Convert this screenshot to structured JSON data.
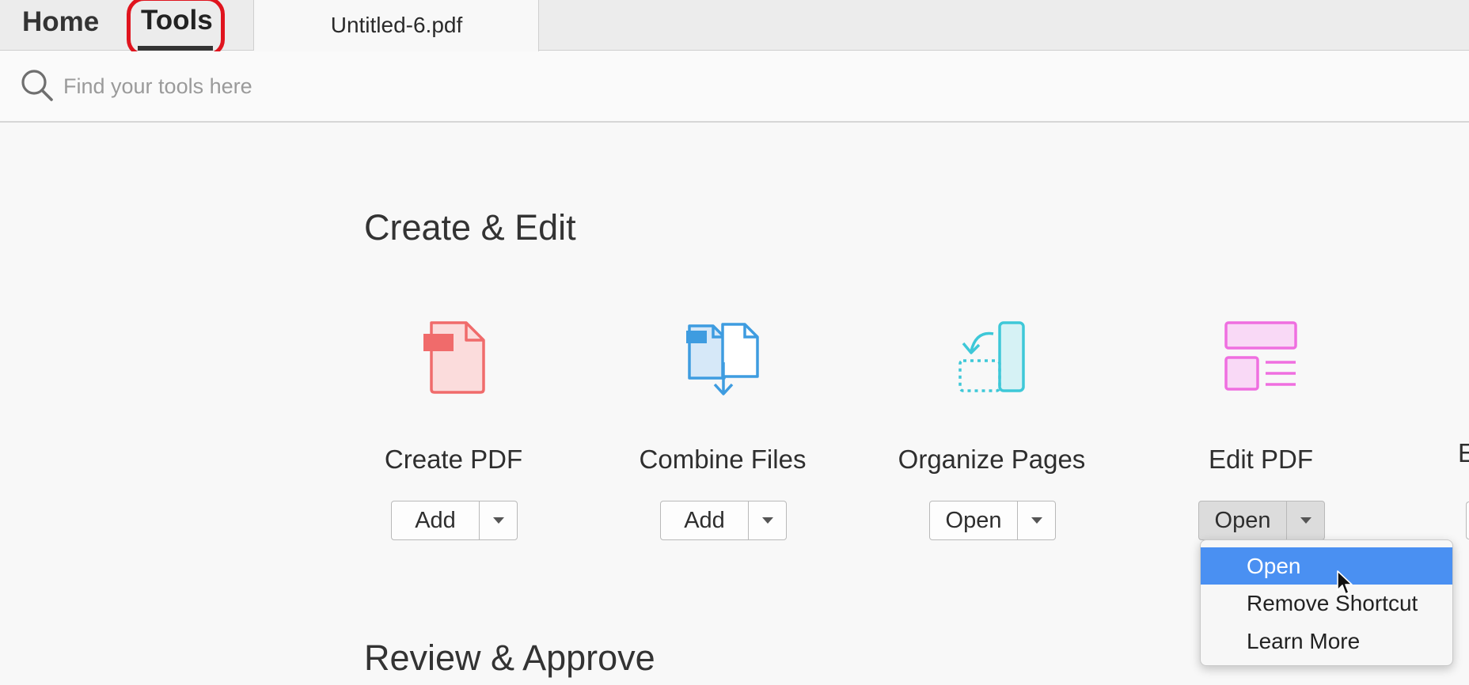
{
  "tabs": {
    "home": "Home",
    "tools": "Tools",
    "document": "Untitled-6.pdf"
  },
  "search": {
    "placeholder": "Find your tools here",
    "icon": "search-icon"
  },
  "sections": {
    "create_edit": "Create & Edit",
    "review_approve": "Review & Approve"
  },
  "tools": [
    {
      "name": "Create PDF",
      "action": "Add",
      "icon": "create-pdf-icon",
      "color": "#f06b6b"
    },
    {
      "name": "Combine Files",
      "action": "Add",
      "icon": "combine-files-icon",
      "color": "#3e9ce0"
    },
    {
      "name": "Organize Pages",
      "action": "Open",
      "icon": "organize-pages-icon",
      "color": "#3ec8d8"
    },
    {
      "name": "Edit PDF",
      "action": "Open",
      "icon": "edit-pdf-icon",
      "color": "#ef6fe0"
    }
  ],
  "partial_tool_initial": "E",
  "dropdown": {
    "items": [
      "Open",
      "Remove Shortcut",
      "Learn More"
    ],
    "highlighted": "Open"
  },
  "colors": {
    "highlight_ring": "#e0141e",
    "menu_selection": "#4a90f2"
  }
}
